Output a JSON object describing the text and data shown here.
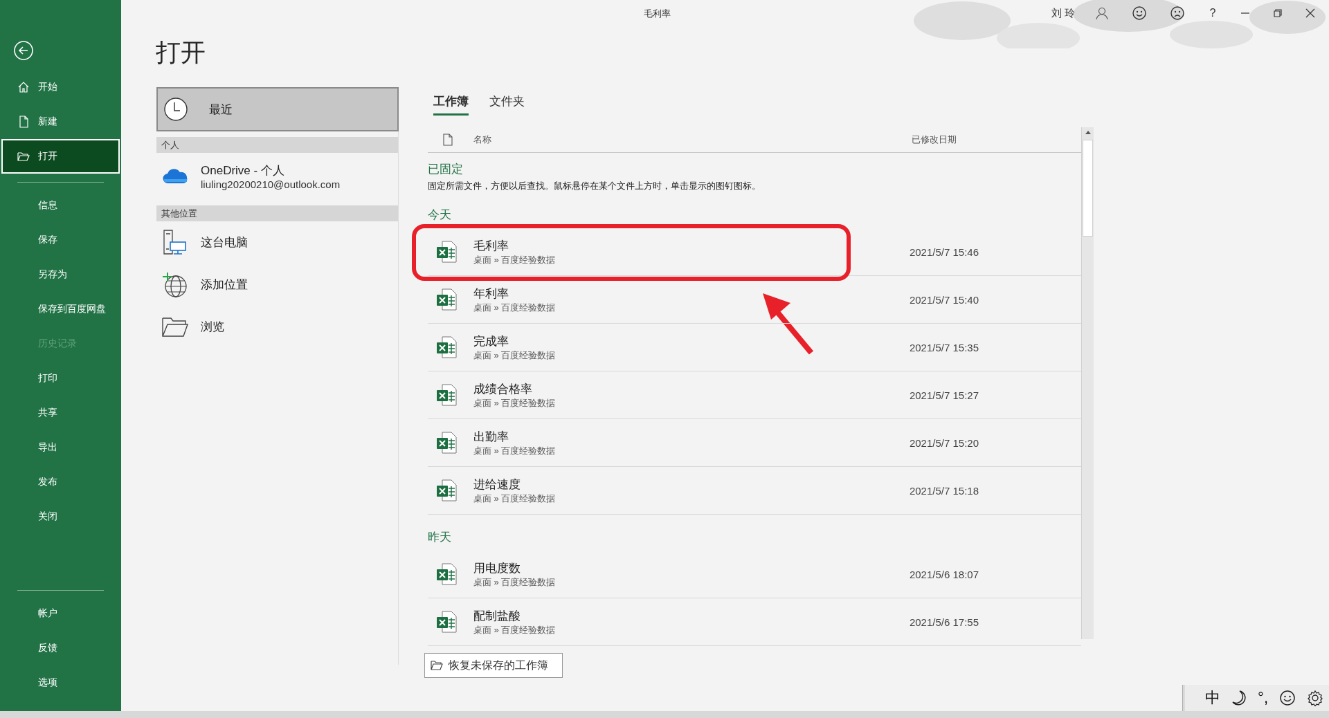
{
  "window": {
    "title": "毛利率",
    "user": "刘 玲",
    "help": "?"
  },
  "sidebar": {
    "sections": [
      {
        "items": [
          {
            "kind": "home",
            "label": "开始",
            "selected": false,
            "disabled": false
          },
          {
            "kind": "new",
            "label": "新建",
            "selected": false,
            "disabled": false
          },
          {
            "kind": "open",
            "label": "打开",
            "selected": true,
            "disabled": false
          }
        ]
      },
      {
        "items": [
          {
            "kind": "text",
            "label": "信息",
            "selected": false,
            "disabled": false
          },
          {
            "kind": "text",
            "label": "保存",
            "selected": false,
            "disabled": false
          },
          {
            "kind": "text",
            "label": "另存为",
            "selected": false,
            "disabled": false
          },
          {
            "kind": "text",
            "label": "保存到百度网盘",
            "selected": false,
            "disabled": false
          },
          {
            "kind": "text",
            "label": "历史记录",
            "selected": false,
            "disabled": true
          },
          {
            "kind": "text",
            "label": "打印",
            "selected": false,
            "disabled": false
          },
          {
            "kind": "text",
            "label": "共享",
            "selected": false,
            "disabled": false
          },
          {
            "kind": "text",
            "label": "导出",
            "selected": false,
            "disabled": false
          },
          {
            "kind": "text",
            "label": "发布",
            "selected": false,
            "disabled": false
          },
          {
            "kind": "text",
            "label": "关闭",
            "selected": false,
            "disabled": false
          }
        ]
      },
      {
        "items": [
          {
            "kind": "text",
            "label": "帐户",
            "selected": false,
            "disabled": false
          },
          {
            "kind": "text",
            "label": "反馈",
            "selected": false,
            "disabled": false
          },
          {
            "kind": "text",
            "label": "选项",
            "selected": false,
            "disabled": false
          }
        ]
      }
    ]
  },
  "page_title": "打开",
  "locations": {
    "recent": {
      "label": "最近",
      "selected": true
    },
    "groups": [
      {
        "heading": "个人",
        "items": [
          {
            "kind": "onedrive",
            "label": "OneDrive - 个人",
            "sublabel": "liuling20200210@outlook.com"
          }
        ]
      },
      {
        "heading": "其他位置",
        "items": [
          {
            "kind": "pc",
            "label": "这台电脑"
          },
          {
            "kind": "add",
            "label": "添加位置"
          },
          {
            "kind": "browse",
            "label": "浏览"
          }
        ]
      }
    ]
  },
  "tabs": [
    {
      "label": "工作簿",
      "selected": true
    },
    {
      "label": "文件夹",
      "selected": false
    }
  ],
  "columns": [
    "名称",
    "已修改日期"
  ],
  "pinned": {
    "heading": "已固定",
    "hint": "固定所需文件，方便以后查找。鼠标悬停在某个文件上方时，单击显示的图钉图标。"
  },
  "groups": [
    {
      "heading": "今天",
      "files": [
        {
          "name": "毛利率",
          "path": "桌面 » 百度经验数据",
          "date": "2021/5/7 15:46",
          "highlighted": true
        },
        {
          "name": "年利率",
          "path": "桌面 » 百度经验数据",
          "date": "2021/5/7 15:40",
          "highlighted": false
        },
        {
          "name": "完成率",
          "path": "桌面 » 百度经验数据",
          "date": "2021/5/7 15:35",
          "highlighted": false
        },
        {
          "name": "成绩合格率",
          "path": "桌面 » 百度经验数据",
          "date": "2021/5/7 15:27",
          "highlighted": false
        },
        {
          "name": "出勤率",
          "path": "桌面 » 百度经验数据",
          "date": "2021/5/7 15:20",
          "highlighted": false
        },
        {
          "name": "进给速度",
          "path": "桌面 » 百度经验数据",
          "date": "2021/5/7 15:18",
          "highlighted": false
        }
      ]
    },
    {
      "heading": "昨天",
      "files": [
        {
          "name": "用电度数",
          "path": "桌面 » 百度经验数据",
          "date": "2021/5/6 18:07",
          "highlighted": false
        },
        {
          "name": "配制盐酸",
          "path": "桌面 » 百度经验数据",
          "date": "2021/5/6 17:55",
          "highlighted": false
        }
      ]
    }
  ],
  "recover_button": "恢复未保存的工作簿",
  "ime": {
    "mode": "中",
    "punctuation": "°,"
  }
}
